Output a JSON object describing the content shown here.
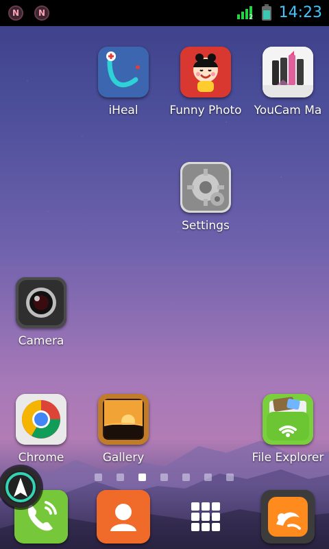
{
  "status_bar": {
    "notifications": [
      "N",
      "N"
    ],
    "time": "14:23"
  },
  "apps": [
    {
      "label": "iHeal"
    },
    {
      "label": "Funny Photo"
    },
    {
      "label": "YouCam Ma"
    },
    {
      "label": "Settings"
    },
    {
      "label": "Camera"
    },
    {
      "label": "Chrome"
    },
    {
      "label": "Gallery"
    },
    {
      "label": "File Explorer"
    }
  ],
  "page_indicator": {
    "count": 7,
    "active_index": 2
  },
  "dock": {
    "items": [
      "phone-icon",
      "contacts-icon",
      "app-drawer-icon",
      "uc-browser-icon"
    ]
  }
}
